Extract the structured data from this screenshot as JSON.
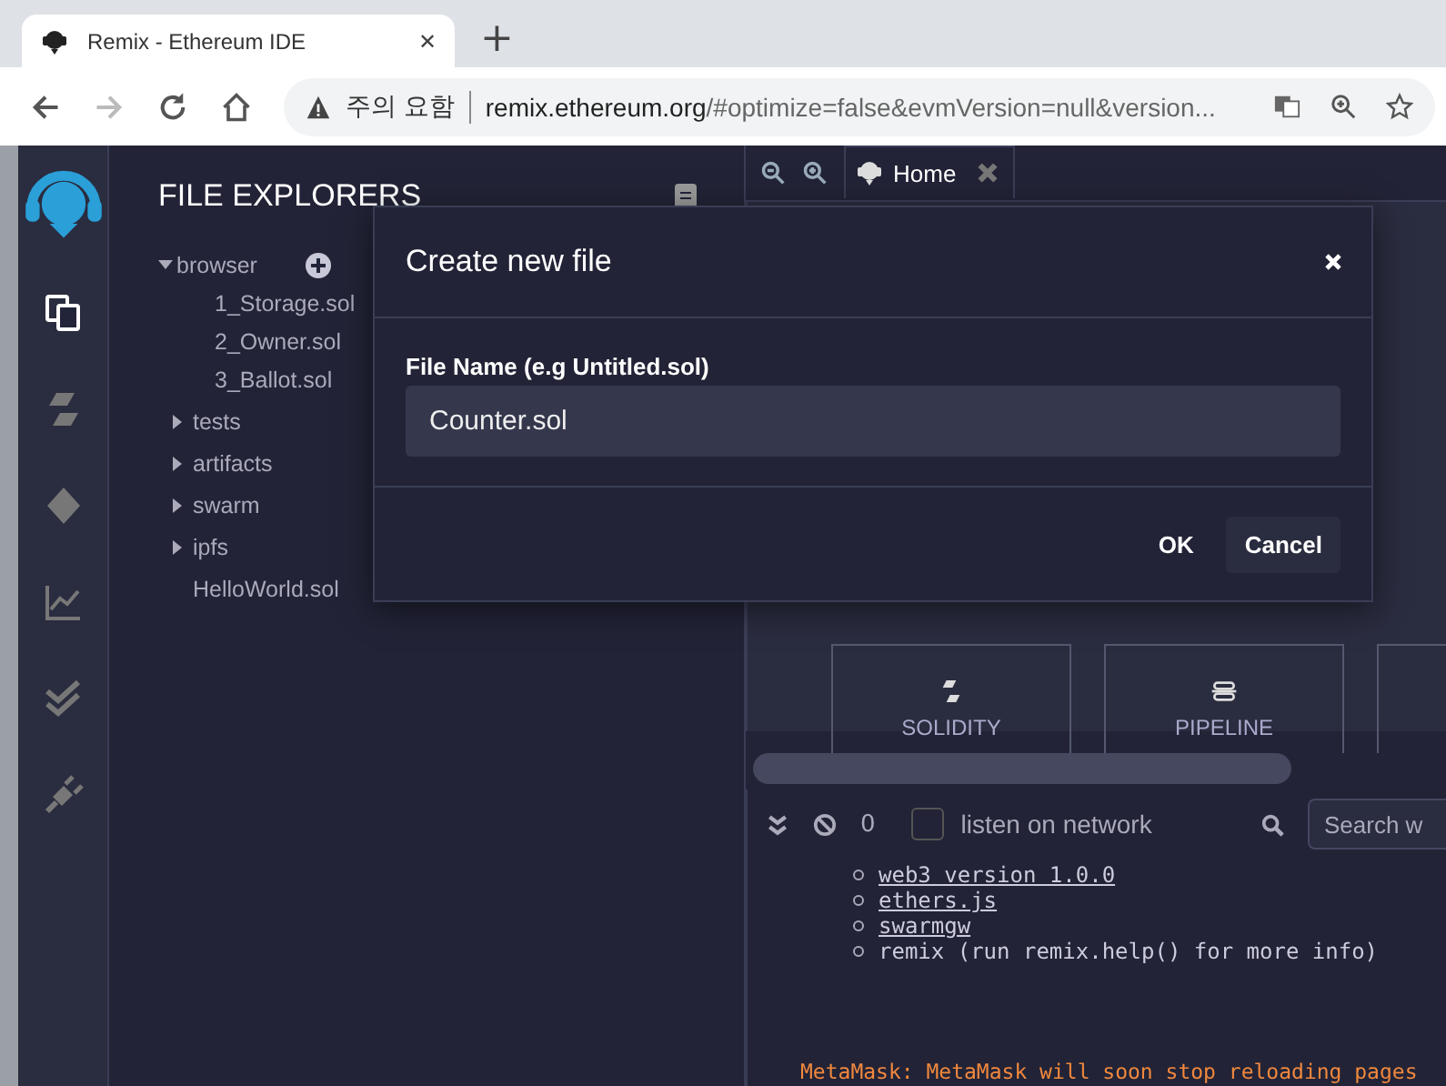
{
  "browser": {
    "tab_title": "Remix - Ethereum IDE",
    "tab_close": "✕",
    "new_tab": "+",
    "security_label": "주의 요함",
    "url_host": "remix.ethereum.org",
    "url_rest": "/#optimize=false&evmVersion=null&version..."
  },
  "file_explorer": {
    "title": "FILE EXPLORERS",
    "tree": [
      {
        "label": "browser",
        "kind": "folder",
        "expanded": true,
        "children": [
          {
            "label": "1_Storage.sol",
            "kind": "file"
          },
          {
            "label": "2_Owner.sol",
            "kind": "file"
          },
          {
            "label": "3_Ballot.sol",
            "kind": "file"
          }
        ]
      },
      {
        "label": "tests",
        "kind": "folder",
        "expanded": false
      },
      {
        "label": "artifacts",
        "kind": "folder",
        "expanded": false
      },
      {
        "label": "swarm",
        "kind": "folder",
        "expanded": false
      },
      {
        "label": "ipfs",
        "kind": "folder",
        "expanded": false
      },
      {
        "label": "HelloWorld.sol",
        "kind": "file"
      }
    ]
  },
  "editor_tabs": [
    {
      "label": "Home",
      "selected": true
    }
  ],
  "featured_plugins": [
    {
      "label": "SOLIDITY",
      "kind": "compiler"
    },
    {
      "label": "PIPELINE",
      "kind": "pipeline"
    },
    {
      "kind": "blank"
    }
  ],
  "terminal": {
    "count": "0",
    "listen_on_network": false,
    "listen_label": "listen on network",
    "search_placeholder": "Search w",
    "lines": [
      {
        "text": "web3 version 1.0.0",
        "kind": "link"
      },
      {
        "text": "ethers.js",
        "kind": "link"
      },
      {
        "text": "swarmgw",
        "kind": "link"
      },
      {
        "text": "remix (run remix.help() for more info)",
        "kind": "plain"
      }
    ],
    "warning": "MetaMask: MetaMask will soon stop reloading pages"
  },
  "dialog": {
    "title": "Create new file",
    "field_label": "File Name (e.g Untitled.sol)",
    "value": "Counter.sol",
    "buttons": [
      {
        "label": "OK",
        "kind": "plain"
      },
      {
        "label": "Cancel",
        "kind": "filled"
      }
    ]
  }
}
